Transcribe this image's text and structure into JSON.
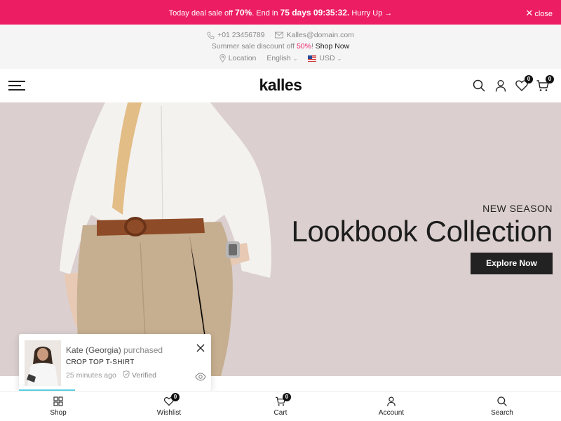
{
  "promo": {
    "text_a": "Today deal sale off ",
    "percent": "70%",
    "text_b": ". End in ",
    "countdown": "75 days 09:35:32.",
    "hurry": " Hurry Up →",
    "close_label": "close"
  },
  "topinfo": {
    "phone": "+01 23456789",
    "email": "Kalles@domain.com",
    "sale_text": "Summer sale discount off ",
    "sale_pct": "50%",
    "sale_bang": "! ",
    "shop_now": "Shop Now",
    "location": "Location",
    "language": "English",
    "currency": "USD"
  },
  "header": {
    "logo": "kalles",
    "wishlist_count": "0",
    "cart_count": "0"
  },
  "hero": {
    "kicker": "NEW SEASON",
    "title": "Lookbook Collection",
    "cta": "Explore Now"
  },
  "popup": {
    "customer": "Kate (Georgia)",
    "action": " purchased",
    "product": "CROP TOP T-SHIRT",
    "time": "25 minutes ago",
    "verified": "Verified"
  },
  "bottom_nav": {
    "shop": "Shop",
    "wishlist": "Wishlist",
    "wishlist_count": "0",
    "cart": "Cart",
    "cart_count": "0",
    "account": "Account",
    "search": "Search"
  }
}
